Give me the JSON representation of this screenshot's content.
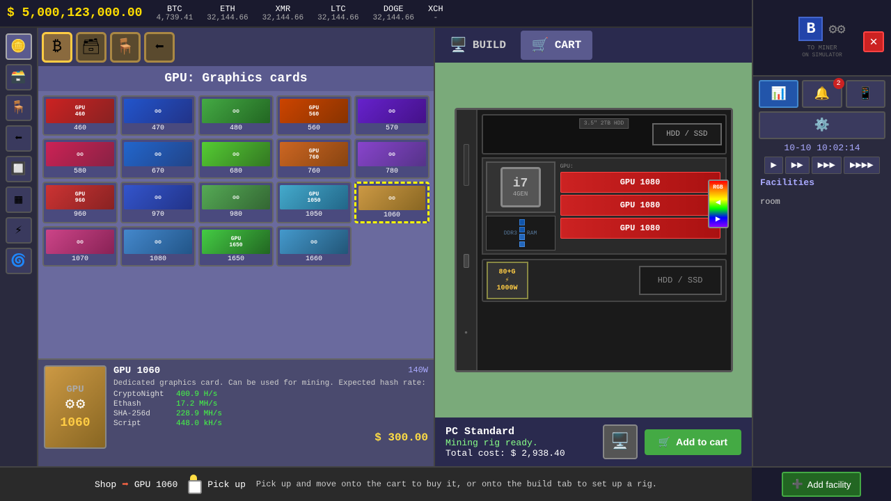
{
  "topbar": {
    "money": "$ 5,000,123,000.00",
    "cryptos": [
      {
        "symbol": "BTC",
        "value": "4,739.41"
      },
      {
        "symbol": "ETH",
        "value": "32,144.66"
      },
      {
        "symbol": "XMR",
        "value": "32,144.66"
      },
      {
        "symbol": "LTC",
        "value": "32,144.66"
      },
      {
        "symbol": "DOGE",
        "value": "32,144.66"
      },
      {
        "symbol": "XCH",
        "value": "-"
      }
    ]
  },
  "shop": {
    "title": "GPU: Graphics cards",
    "gpus": [
      {
        "label": "GPU",
        "model": "460",
        "class": "gpu-460"
      },
      {
        "label": "GPU",
        "model": "470",
        "class": "gpu-470"
      },
      {
        "label": "GPU",
        "model": "480",
        "class": "gpu-480"
      },
      {
        "label": "GPU",
        "model": "560",
        "class": "gpu-560"
      },
      {
        "label": "GPU",
        "model": "570",
        "class": "gpu-570"
      },
      {
        "label": "GPU",
        "model": "580",
        "class": "gpu-580"
      },
      {
        "label": "GPU",
        "model": "670",
        "class": "gpu-670"
      },
      {
        "label": "GPU",
        "model": "680",
        "class": "gpu-680"
      },
      {
        "label": "GPU",
        "model": "760",
        "class": "gpu-760"
      },
      {
        "label": "GPU",
        "model": "780",
        "class": "gpu-780"
      },
      {
        "label": "GPU",
        "model": "960",
        "class": "gpu-960"
      },
      {
        "label": "GPU",
        "model": "970",
        "class": "gpu-970"
      },
      {
        "label": "GPU",
        "model": "980",
        "class": "gpu-980"
      },
      {
        "label": "GPU",
        "model": "1050",
        "class": "gpu-1050"
      },
      {
        "label": "GPU",
        "model": "1060",
        "class": "gpu-1060",
        "selected": true
      },
      {
        "label": "GPU",
        "model": "1070",
        "class": "gpu-1070"
      },
      {
        "label": "GPU",
        "model": "1080",
        "class": "gpu-1080"
      },
      {
        "label": "GPU",
        "model": "1650",
        "class": "gpu-1650"
      },
      {
        "label": "GPU",
        "model": "1660",
        "class": "gpu-1660"
      }
    ]
  },
  "detail": {
    "name": "GPU 1060",
    "watts": "140W",
    "description": "Dedicated graphics card. Can be used for mining. Expected hash rate:",
    "hashes": [
      {
        "algo": "CryptoNight",
        "value": "400.9 H/s"
      },
      {
        "algo": "Ethash",
        "value": "17.2 MH/s"
      },
      {
        "algo": "SHA-256d",
        "value": "228.9 MH/s"
      },
      {
        "algo": "Script",
        "value": "448.0 kH/s"
      }
    ],
    "price": "$ 300.00"
  },
  "build": {
    "tabs": [
      {
        "label": "BUILD",
        "icon": "🖥️"
      },
      {
        "label": "CART",
        "icon": "🛒"
      }
    ],
    "hdd_badge": "3.5\" 2TB HDD",
    "hdd_label": "HDD / SSD",
    "cpu_label": "i7",
    "cpu_gen": "4GEN",
    "ddr_label": "DDR3",
    "ram_label": "RAM",
    "gpu_slots": [
      "GPU 1080",
      "GPU 1080",
      "GPU 1080"
    ],
    "psu_label": "80+G\n1000W",
    "psu_hdd": "HDD / SSD"
  },
  "pc_info": {
    "name": "PC Standard",
    "status": "Mining rig ready.",
    "cost": "Total cost: $ 2,938.40",
    "add_to_cart": "Add to cart"
  },
  "breadcrumb": {
    "shop": "Shop",
    "arrow": "➡",
    "item": "GPU 1060"
  },
  "pickup": {
    "label": "Pick up",
    "help": "Pick up and move onto the cart to buy it, or onto the build tab to set up a rig."
  },
  "right_panel": {
    "datetime": "10-10 10:02:14",
    "facilities_title": "Facilities",
    "room_label": "room",
    "add_facility": "Add facility",
    "notification_count": "2"
  }
}
